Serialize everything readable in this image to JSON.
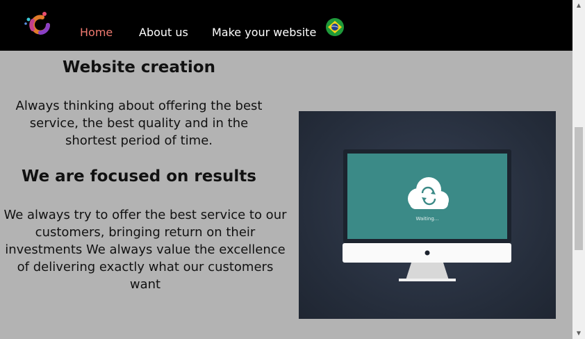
{
  "navbar": {
    "logo": "brand-logo-icon",
    "links": [
      {
        "label": "Home",
        "active": true
      },
      {
        "label": "About us",
        "active": false
      },
      {
        "label": "Make your website",
        "active": false
      }
    ],
    "language_flag": "brazil-flag-icon",
    "colors": {
      "background": "#000000",
      "active_link": "#f07a70",
      "link": "#ffffff"
    }
  },
  "content": {
    "title": "Website creation",
    "intro": "Always thinking about offering the best service, the best quality and in the shortest period of time.",
    "subtitle": "We are focused on results",
    "body": "We always try to offer the best service to our customers, bringing return on their investments We always value the excellence of delivering exactly what our customers want"
  },
  "illustration": {
    "screen_status": "Waiting...",
    "icon": "cloud-sync-icon"
  },
  "page": {
    "background": "#b3b3b3"
  }
}
